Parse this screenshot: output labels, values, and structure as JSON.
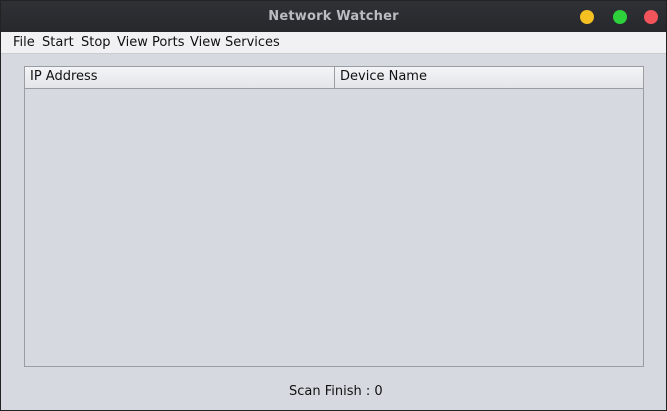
{
  "window": {
    "title": "Network Watcher",
    "controls": {
      "minimize_color": "#f5c022",
      "maximize_color": "#2ed03b",
      "close_color": "#f2545b"
    }
  },
  "menu": {
    "file": "File",
    "start": "Start",
    "stop": "Stop",
    "view_ports": "View Ports",
    "view_services": "View Services"
  },
  "table": {
    "columns": [
      "IP Address",
      "Device Name"
    ],
    "rows": []
  },
  "status": {
    "text": "Scan Finish : 0"
  }
}
